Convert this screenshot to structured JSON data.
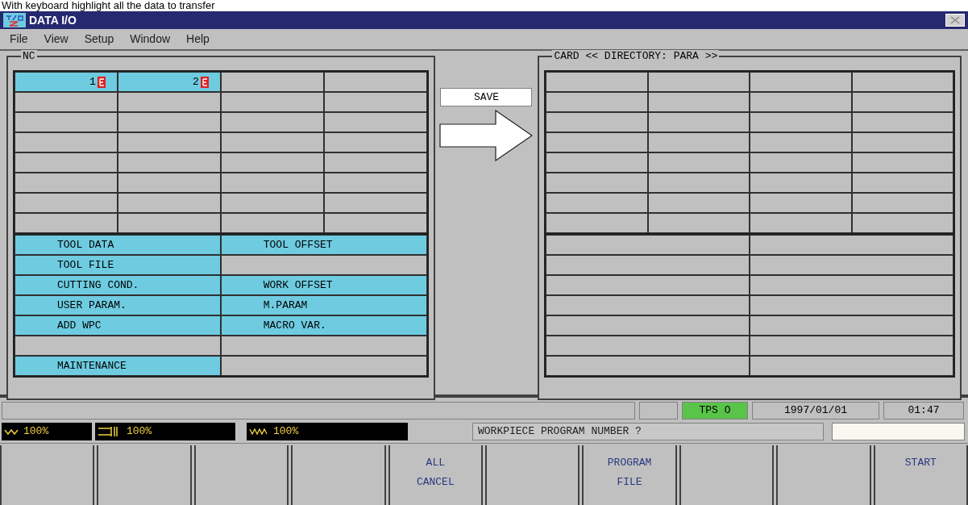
{
  "caption": "With keyboard highlight all the data to transfer",
  "window": {
    "title": "DATA I/O"
  },
  "menu": [
    "File",
    "View",
    "Setup",
    "Window",
    "Help"
  ],
  "nc": {
    "title": "NC",
    "files": [
      {
        "text": "1",
        "selected": true
      },
      {
        "text": "2",
        "selected": true
      }
    ],
    "data_types": [
      [
        {
          "label": "TOOL DATA",
          "selected": true
        },
        {
          "label": "TOOL OFFSET",
          "selected": true
        }
      ],
      [
        {
          "label": "TOOL FILE",
          "selected": true
        },
        {
          "selected": false
        }
      ],
      [
        {
          "label": "CUTTING COND.",
          "selected": true
        },
        {
          "label": "WORK OFFSET",
          "selected": true
        }
      ],
      [
        {
          "label": "USER PARAM.",
          "selected": true
        },
        {
          "label": "M.PARAM",
          "selected": true
        }
      ],
      [
        {
          "label": "ADD WPC",
          "selected": true
        },
        {
          "label": "MACRO VAR.",
          "selected": true
        }
      ],
      [
        {
          "selected": false
        },
        {
          "selected": false
        }
      ],
      [
        {
          "label": "MAINTENANCE",
          "selected": true
        },
        {
          "selected": false
        }
      ]
    ]
  },
  "transfer": {
    "label": "SAVE"
  },
  "card": {
    "title": "CARD << DIRECTORY: PARA >>"
  },
  "status_bar": {
    "tps": "TPS O",
    "date": "1997/01/01",
    "time": "01:47"
  },
  "overrides": [
    {
      "kind": "spindle",
      "reading": "100%"
    },
    {
      "kind": "feed",
      "reading": "100%"
    },
    {
      "kind": "rapid",
      "reading": "100%"
    }
  ],
  "prompt": {
    "message": "WORKPIECE PROGRAM NUMBER ?"
  },
  "softkeys": [
    {
      "kind": "blank"
    },
    {
      "kind": "blank"
    },
    {
      "kind": "blank"
    },
    {
      "kind": "blank"
    },
    {
      "kind": "labeled",
      "label": "ALL\nCANCEL"
    },
    {
      "kind": "blank"
    },
    {
      "kind": "labeled",
      "label": "PROGRAM\nFILE"
    },
    {
      "kind": "blank"
    },
    {
      "kind": "blank"
    },
    {
      "kind": "labeled",
      "label": "START"
    }
  ]
}
